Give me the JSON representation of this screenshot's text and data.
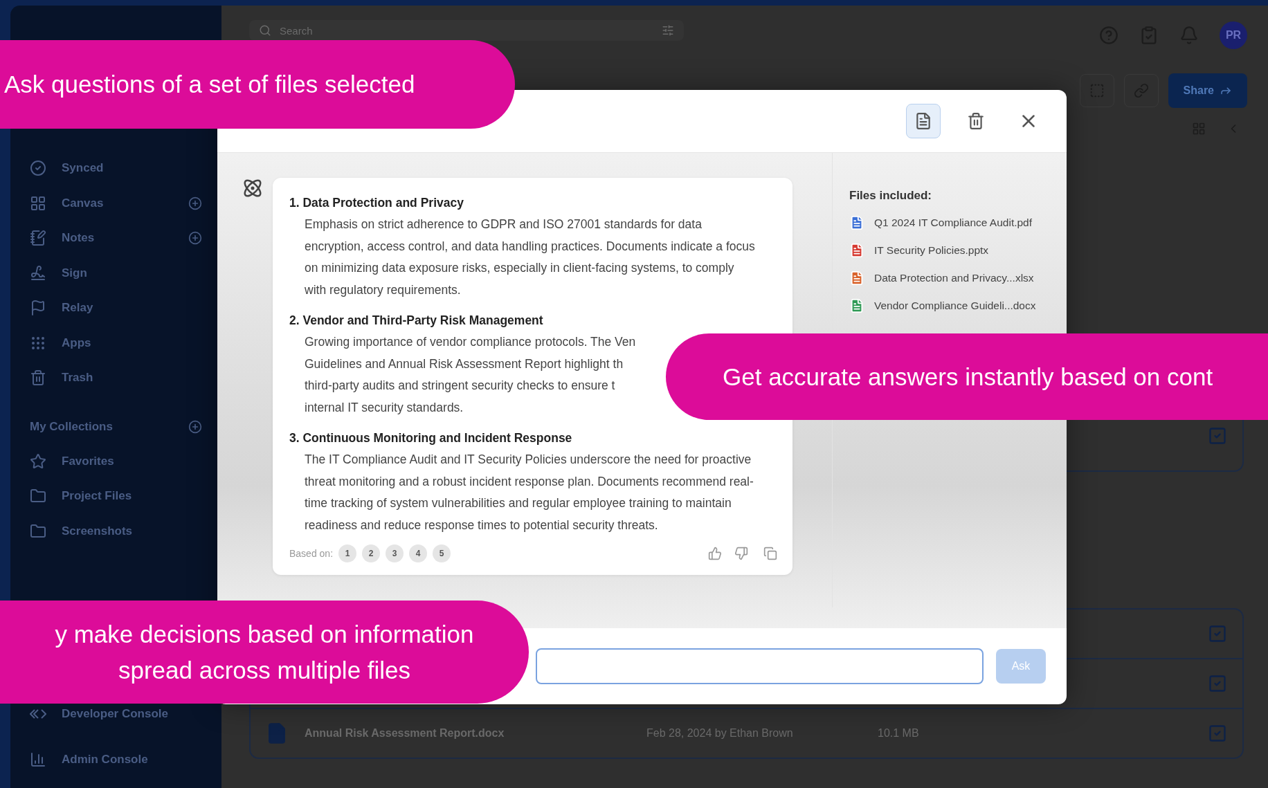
{
  "sidebar": {
    "items": [
      {
        "label": "Synced",
        "add": false
      },
      {
        "label": "Canvas",
        "add": true
      },
      {
        "label": "Notes",
        "add": true
      },
      {
        "label": "Sign",
        "add": false
      },
      {
        "label": "Relay",
        "add": false
      },
      {
        "label": "Apps",
        "add": false
      },
      {
        "label": "Trash",
        "add": false
      }
    ],
    "collections": {
      "title": "My Collections",
      "items": [
        {
          "label": "Favorites"
        },
        {
          "label": "Project Files"
        },
        {
          "label": "Screenshots"
        }
      ]
    },
    "bottom": [
      {
        "label": "Developer Console"
      },
      {
        "label": "Admin Console"
      }
    ]
  },
  "topbar": {
    "search": {
      "placeholder": "Search"
    },
    "avatar": "PR"
  },
  "toolbar": {
    "share": "Share"
  },
  "table": {
    "rows": [
      {
        "name": "Annual Risk Assessment Report.docx",
        "date": "Feb 28, 2024 by Ethan Brown",
        "size": "10.1 MB",
        "checked": true
      }
    ],
    "hidden_rows": [
      {
        "checked": true
      },
      {
        "checked": true
      },
      {
        "checked": true
      }
    ]
  },
  "modal": {
    "header": {
      "files_toggle": {
        "selected": true
      }
    },
    "answer": {
      "items": [
        {
          "number": "1.",
          "title": "Data Protection and Privacy",
          "text": "Emphasis on strict adherence to GDPR and ISO 27001 standards for data encryption, access control, and data handling practices. Documents indicate a focus on minimizing data exposure risks, especially in client-facing systems, to comply with regulatory requirements."
        },
        {
          "number": "2.",
          "title": "Vendor and Third-Party Risk Management",
          "lines": [
            "Growing importance of vendor compliance protocols. The Ven",
            "Guidelines and Annual Risk Assessment Report highlight th",
            "third-party audits and stringent security checks to ensure t",
            "internal IT security standards."
          ]
        },
        {
          "number": "3.",
          "title": "Continuous Monitoring and Incident Response",
          "text": "The IT Compliance Audit and IT Security Policies underscore the need for proactive threat monitoring and a robust incident response plan. Documents recommend real-time tracking of system vulnerabilities and regular employee training to maintain readiness and reduce response times to potential security threats."
        }
      ],
      "based_on_label": "Based on:",
      "sources": [
        "1",
        "2",
        "3",
        "4",
        "5"
      ]
    },
    "files": {
      "title": "Files included:",
      "items": [
        {
          "name": "Q1 2024 IT Compliance Audit.pdf",
          "color": "#3b6fd6"
        },
        {
          "name": "IT Security Policies.pptx",
          "color": "#d63a32"
        },
        {
          "name": "Data Protection and Privacy...xlsx",
          "color": "#d9622b"
        },
        {
          "name": "Vendor Compliance Guideli...docx",
          "color": "#2f9a55"
        }
      ]
    },
    "ask": {
      "label": "Ask",
      "disabled": true
    }
  },
  "callouts": [
    {
      "lines": [
        "Ask questions of a set of files selected"
      ]
    },
    {
      "lines": [
        "Get accurate answers instantly based on cont"
      ]
    },
    {
      "lines": [
        "y make decisions based on information",
        "spread across multiple files"
      ]
    }
  ]
}
